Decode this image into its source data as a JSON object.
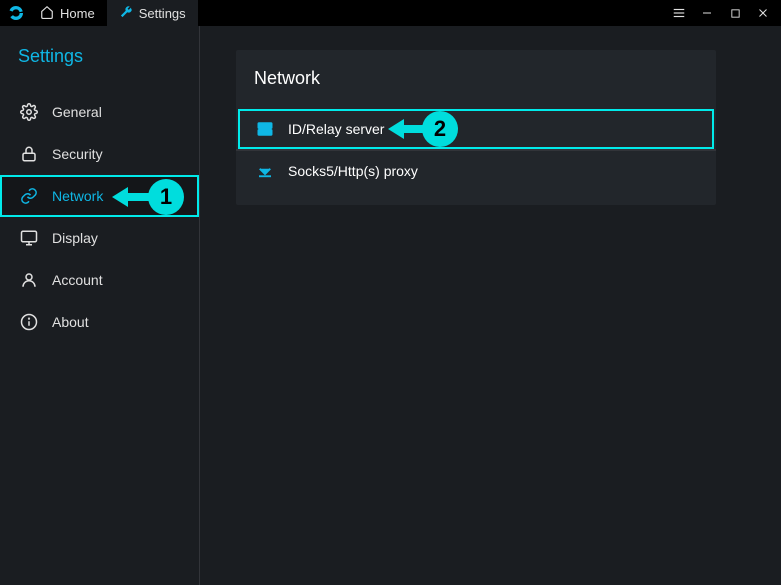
{
  "colors": {
    "accent": "#0fb7e5",
    "callout": "#00dddd"
  },
  "titlebar": {
    "tabs": {
      "home": "Home",
      "settings": "Settings"
    }
  },
  "sidebar": {
    "title": "Settings",
    "items": {
      "general": "General",
      "security": "Security",
      "network": "Network",
      "display": "Display",
      "account": "Account",
      "about": "About"
    }
  },
  "main": {
    "section_title": "Network",
    "options": {
      "id_relay": "ID/Relay server",
      "proxy": "Socks5/Http(s) proxy"
    }
  },
  "callouts": {
    "one": "1",
    "two": "2"
  }
}
